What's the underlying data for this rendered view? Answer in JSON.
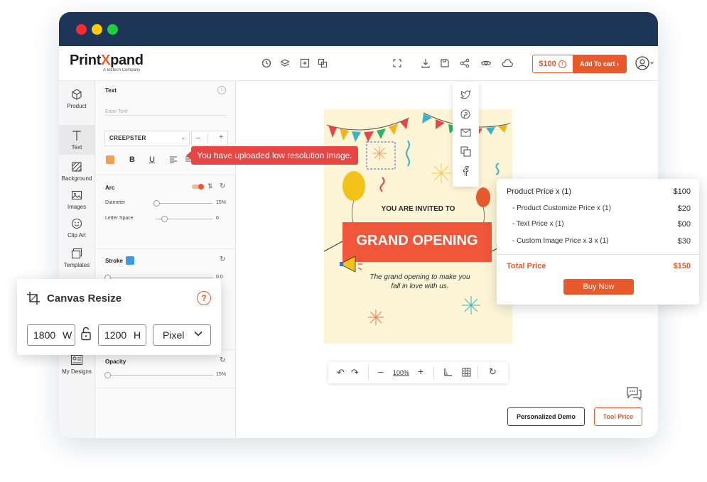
{
  "window": {
    "controls": [
      "close",
      "minimize",
      "maximize"
    ]
  },
  "brand": {
    "name_a": "Print",
    "name_b": "X",
    "name_c": "pand",
    "tagline": "A Biztech Company"
  },
  "toolbar": {
    "price": "$100",
    "add_to_cart": "Add To cart"
  },
  "share_menu": {
    "items": [
      "twitter-icon",
      "pinterest-icon",
      "email-icon",
      "copy-icon",
      "facebook-icon"
    ]
  },
  "sidebar": {
    "items": [
      {
        "label": "Product"
      },
      {
        "label": "Text"
      },
      {
        "label": "Background"
      },
      {
        "label": "Images"
      },
      {
        "label": "Clip Art"
      },
      {
        "label": "Templates"
      },
      {
        "label": "My Designs"
      }
    ]
  },
  "panel": {
    "text_title": "Text",
    "text_placeholder": "Enter Text",
    "font_name": "CREEPSTER",
    "size_minus": "–",
    "size_plus": "+",
    "bold": "B",
    "underline": "U",
    "arc_title": "Arc",
    "diameter_label": "Diameter",
    "diameter_value": "15%",
    "letter_space_label": "Letter Space",
    "letter_space_value": "0",
    "stroke_title": "Stroke",
    "stroke_value": "0.0",
    "opacity_title": "Opacity",
    "opacity_value": "15%",
    "colors": {
      "text_color": "#f0a050",
      "stroke_color": "#3b9be0"
    }
  },
  "warning": {
    "text": "You have uploaded low resolution image."
  },
  "artwork": {
    "invited": "YOU ARE INVITED TO",
    "headline": "GRAND OPENING",
    "subline_1": "The grand opening to make you",
    "subline_2": "fall in love with us."
  },
  "zoom_bar": {
    "zoom": "100%",
    "minus": "–",
    "plus": "+"
  },
  "canvas_resize": {
    "title": "Canvas Resize",
    "help": "?",
    "width": "1800",
    "width_unit": "W",
    "height": "1200",
    "height_unit": "H",
    "unit_select": "Pixel"
  },
  "price_card": {
    "rows": [
      {
        "label": "Product Price  x  (1)",
        "value": "$100"
      },
      {
        "label": "- Product Customize Price  x  (1)",
        "value": "$20"
      },
      {
        "label": "- Text Price x (1)",
        "value": "$00"
      },
      {
        "label": "- Custom Image Price x 3 x  (1)",
        "value": "$30"
      }
    ],
    "total_label": "Total Price",
    "total_value": "$150",
    "buy_now": "Buy Now"
  },
  "footer": {
    "personalized_demo": "Personalized Demo",
    "tool_price": "Tool Price"
  },
  "colors": {
    "accent": "#e85a2c",
    "titlebar": "#1d3557",
    "warning": "#e84545"
  }
}
